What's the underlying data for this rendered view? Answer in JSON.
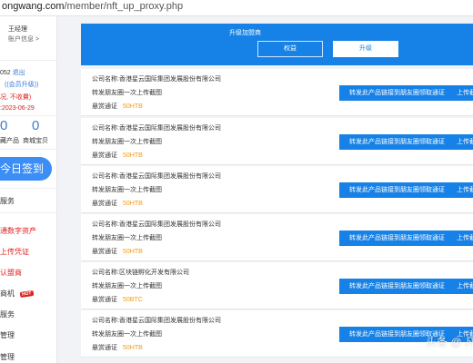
{
  "browser": {
    "url_host": "ongwang.com",
    "url_path": "/member/nft_up_proxy.php"
  },
  "sidebar": {
    "user_name": "王经理",
    "user_info": "账户信息 >",
    "account_num": "052",
    "account_action": "退出",
    "member_upgrade": "((会员升级))",
    "warning": "况, 不收費)",
    "expiry": ":2023-06-29",
    "counts": [
      {
        "value": "0",
        "label": "藏产品"
      },
      {
        "value": "0",
        "label": "商城宝贝"
      }
    ],
    "checkin": "今日签到",
    "menu": [
      {
        "label": "服务",
        "style": "dark"
      },
      {
        "label": "通数字资产",
        "style": "red"
      },
      {
        "label": "上传凭证",
        "style": "red"
      },
      {
        "label": "认盟商",
        "style": "red"
      },
      {
        "label": "商机",
        "style": "dark",
        "badge": "HOT"
      },
      {
        "label": "服务",
        "style": "dark"
      },
      {
        "label": "管理",
        "style": "dark"
      },
      {
        "label": "管理",
        "style": "dark"
      }
    ]
  },
  "banner": {
    "title": "升级加盟商",
    "tab_equity": "权益",
    "tab_upgrade": "升级"
  },
  "labels": {
    "company_prefix": "公司名称:",
    "transfer_text": "转发朋友圈一次上传截图",
    "pass_label": "悬赏通证",
    "action": "转发此产品链接到朋友圈领取通证",
    "upload": "上传截图"
  },
  "cards": [
    {
      "company": "香港星云国际集团发展股份有限公司",
      "reward": "50HTB"
    },
    {
      "company": "香港星云国际集团发展股份有限公司",
      "reward": "50HTB"
    },
    {
      "company": "香港星云国际集团发展股份有限公司",
      "reward": "50HTB"
    },
    {
      "company": "香港星云国际集团发展股份有限公司",
      "reward": "50HTB"
    },
    {
      "company": "区块链孵化开发有限公司",
      "reward": "50BTC"
    },
    {
      "company": "香港星云国际集团发展股份有限公司",
      "reward": "50HTB"
    }
  ],
  "watermark": "头条 @ 凡"
}
